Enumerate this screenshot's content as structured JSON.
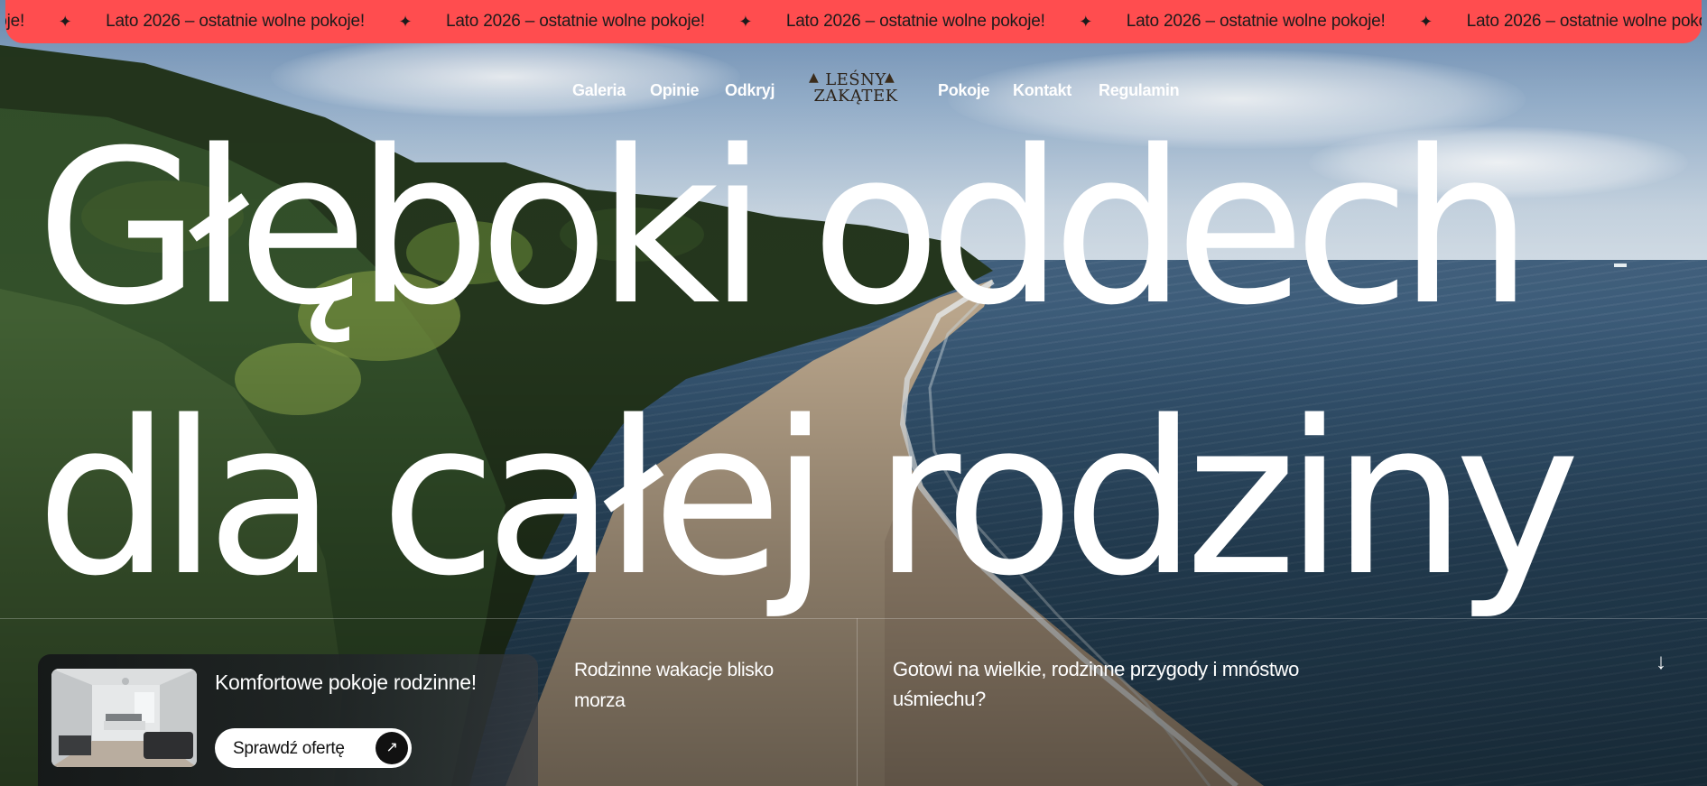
{
  "announcement": {
    "text": "Lato 2026 – ostatnie wolne pokoje!",
    "partial_text": "olne pokoje!",
    "separator": "✦",
    "background_color": "#ff4d4f"
  },
  "nav": {
    "left_items": [
      "Galeria",
      "Opinie",
      "Odkryj"
    ],
    "right_items": [
      "Pokoje",
      "Kontakt",
      "Regulamin"
    ],
    "logo": {
      "line1": "LEŚNY",
      "line2": "ZAKĄTEK",
      "icon": "tree-icon"
    }
  },
  "hero": {
    "headline_line1": "Głęboki oddech",
    "headline_line2": "dla całej rodziny"
  },
  "promo": {
    "title": "Komfortowe pokoje rodzinne!",
    "button_label": "Sprawdź ofertę",
    "button_icon": "arrow-up-right-icon",
    "image_alt_icon": "room-photo"
  },
  "tagline": "Rodzinne wakacje blisko morza",
  "question": "Gotowi na wielkie, rodzinne przygody i mnóstwo uśmiechu?",
  "scroll": {
    "icon": "arrow-down-icon",
    "glyph": "↓"
  }
}
